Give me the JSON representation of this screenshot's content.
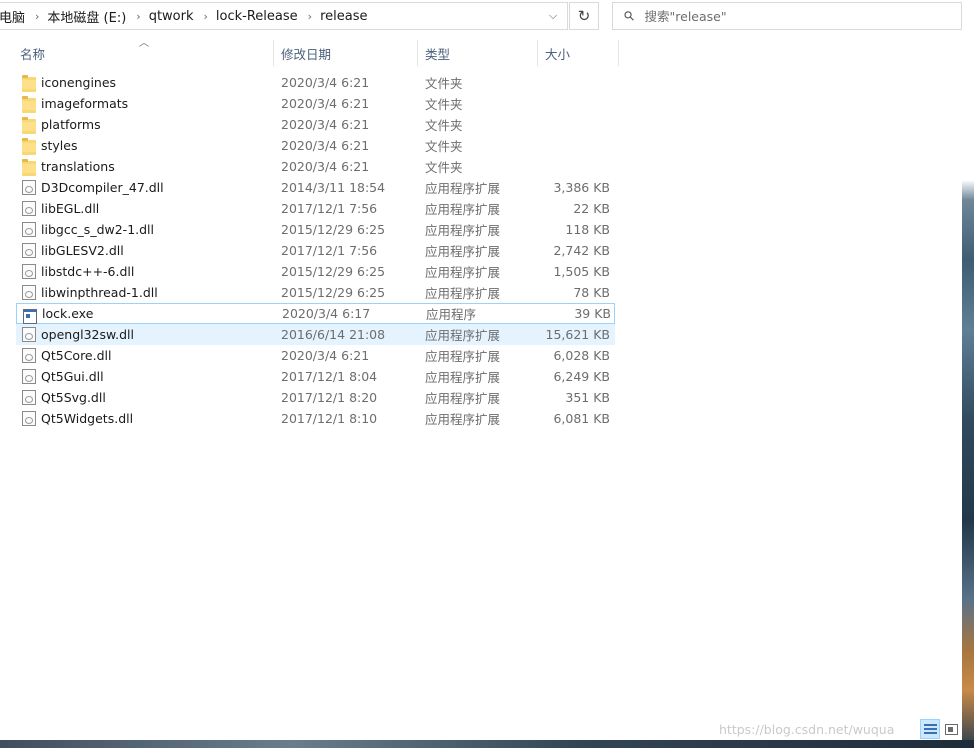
{
  "address": {
    "crumbs": [
      "此电脑",
      "本地磁盘 (E:)",
      "qtwork",
      "lock-Release",
      "release"
    ]
  },
  "search": {
    "placeholder": "搜索\"release\""
  },
  "columns": {
    "name": "名称",
    "date": "修改日期",
    "type": "类型",
    "size": "大小"
  },
  "files": [
    {
      "name": "iconengines",
      "date": "2020/3/4 6:21",
      "type": "文件夹",
      "size": "",
      "icon": "folder-icon"
    },
    {
      "name": "imageformats",
      "date": "2020/3/4 6:21",
      "type": "文件夹",
      "size": "",
      "icon": "folder-icon"
    },
    {
      "name": "platforms",
      "date": "2020/3/4 6:21",
      "type": "文件夹",
      "size": "",
      "icon": "folder-icon"
    },
    {
      "name": "styles",
      "date": "2020/3/4 6:21",
      "type": "文件夹",
      "size": "",
      "icon": "folder-icon"
    },
    {
      "name": "translations",
      "date": "2020/3/4 6:21",
      "type": "文件夹",
      "size": "",
      "icon": "folder-icon"
    },
    {
      "name": "D3Dcompiler_47.dll",
      "date": "2014/3/11 18:54",
      "type": "应用程序扩展",
      "size": "3,386 KB",
      "icon": "dll-file-icon"
    },
    {
      "name": "libEGL.dll",
      "date": "2017/12/1 7:56",
      "type": "应用程序扩展",
      "size": "22 KB",
      "icon": "dll-file-icon"
    },
    {
      "name": "libgcc_s_dw2-1.dll",
      "date": "2015/12/29 6:25",
      "type": "应用程序扩展",
      "size": "118 KB",
      "icon": "dll-file-icon"
    },
    {
      "name": "libGLESV2.dll",
      "date": "2017/12/1 7:56",
      "type": "应用程序扩展",
      "size": "2,742 KB",
      "icon": "dll-file-icon"
    },
    {
      "name": "libstdc++-6.dll",
      "date": "2015/12/29 6:25",
      "type": "应用程序扩展",
      "size": "1,505 KB",
      "icon": "dll-file-icon"
    },
    {
      "name": "libwinpthread-1.dll",
      "date": "2015/12/29 6:25",
      "type": "应用程序扩展",
      "size": "78 KB",
      "icon": "dll-file-icon"
    },
    {
      "name": "lock.exe",
      "date": "2020/3/4 6:17",
      "type": "应用程序",
      "size": "39 KB",
      "icon": "exe-file-icon"
    },
    {
      "name": "opengl32sw.dll",
      "date": "2016/6/14 21:08",
      "type": "应用程序扩展",
      "size": "15,621 KB",
      "icon": "dll-file-icon"
    },
    {
      "name": "Qt5Core.dll",
      "date": "2020/3/4 6:21",
      "type": "应用程序扩展",
      "size": "6,028 KB",
      "icon": "dll-file-icon"
    },
    {
      "name": "Qt5Gui.dll",
      "date": "2017/12/1 8:04",
      "type": "应用程序扩展",
      "size": "6,249 KB",
      "icon": "dll-file-icon"
    },
    {
      "name": "Qt5Svg.dll",
      "date": "2017/12/1 8:20",
      "type": "应用程序扩展",
      "size": "351 KB",
      "icon": "dll-file-icon"
    },
    {
      "name": "Qt5Widgets.dll",
      "date": "2017/12/1 8:10",
      "type": "应用程序扩展",
      "size": "6,081 KB",
      "icon": "dll-file-icon"
    }
  ],
  "selected_file": "lock.exe",
  "hovered_file": "opengl32sw.dll",
  "watermark": "https://blog.csdn.net/wuqua",
  "colors": {
    "accent": "#99d1ff",
    "hover": "#e5f3ff",
    "header_text": "#4c607a"
  }
}
